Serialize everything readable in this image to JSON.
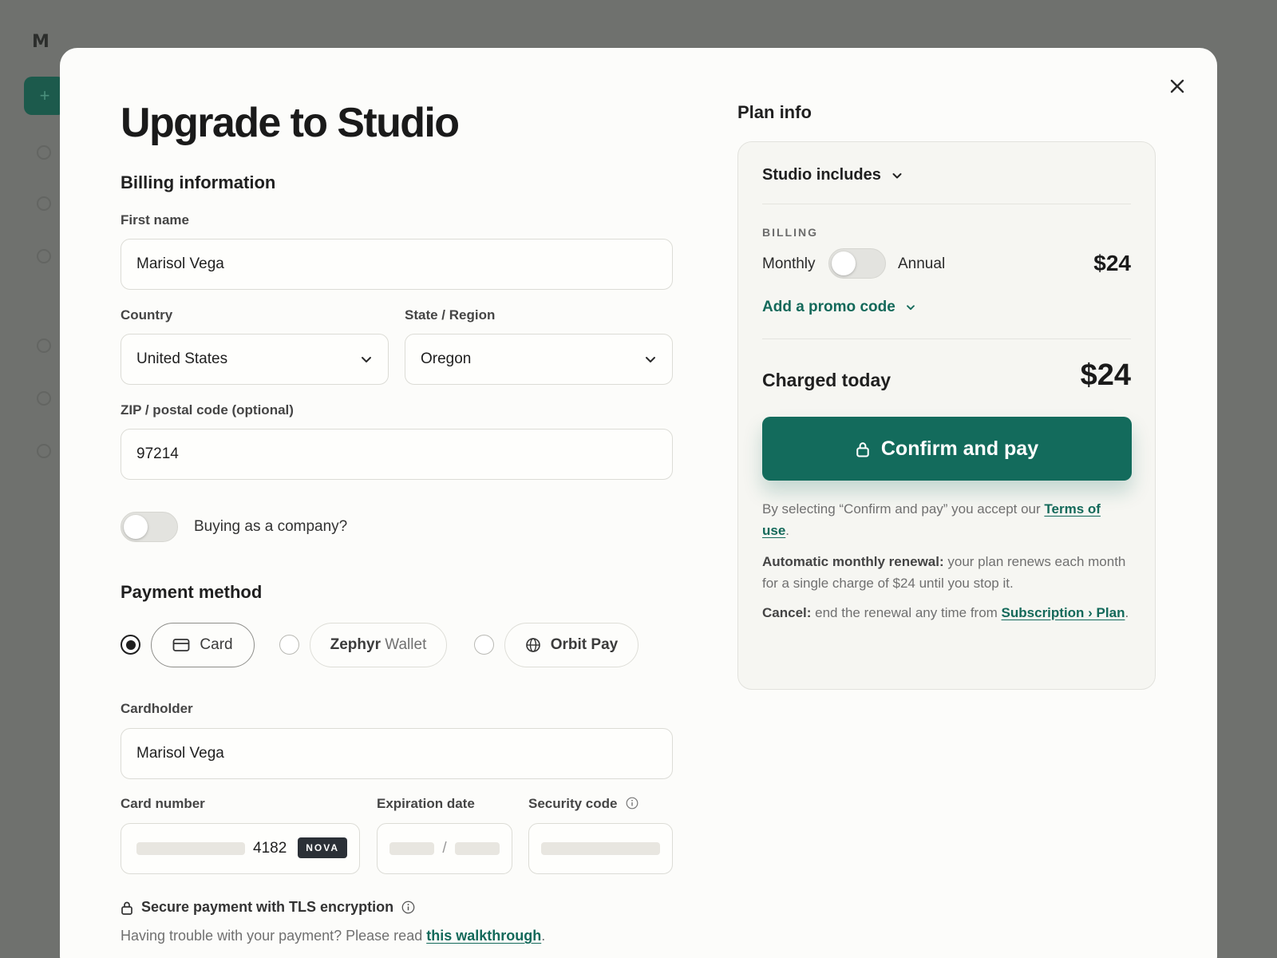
{
  "background": {
    "logo": "M",
    "new_button": "+"
  },
  "modal": {
    "title": "Upgrade to Studio",
    "billing_heading": "Billing information",
    "first_name": {
      "label": "First name",
      "value": "Marisol Vega"
    },
    "country": {
      "label": "Country",
      "value": "United States"
    },
    "state": {
      "label": "State / Region",
      "value": "Oregon"
    },
    "zip": {
      "label": "ZIP / postal code (optional)",
      "value": "97214"
    },
    "company_toggle": {
      "label": "Buying as a company?",
      "on": false
    },
    "payment_heading": "Payment method",
    "payment_options": [
      {
        "label": "Card",
        "selected": true,
        "icon": "credit-card-icon"
      },
      {
        "brand": "Zephyr",
        "suffix": "Wallet",
        "selected": false
      },
      {
        "label": "Orbit Pay",
        "selected": false,
        "icon": "globe-icon"
      }
    ],
    "cardholder": {
      "label": "Cardholder",
      "value": "Marisol Vega"
    },
    "card_number": {
      "label": "Card number",
      "last4": "4182",
      "brand_badge": "NOVA"
    },
    "expiration": {
      "label": "Expiration date",
      "separator": "/"
    },
    "security_code": {
      "label": "Security code"
    },
    "secure_note": "Secure payment with TLS encryption",
    "trouble": {
      "prefix": "Having trouble with your payment? Please read ",
      "link": "this walkthrough",
      "suffix": "."
    }
  },
  "plan": {
    "heading": "Plan info",
    "includes": "Studio includes",
    "billing_label": "BILLING",
    "monthly": "Monthly",
    "annual": "Annual",
    "billing_toggle_annual": false,
    "price": "$24",
    "promo": "Add a promo code",
    "charged_label": "Charged today",
    "charged_amount": "$24",
    "confirm_button": "Confirm and pay",
    "terms": {
      "prefix": "By selecting “Confirm and pay” you accept our ",
      "link": "Terms of use",
      "suffix": "."
    },
    "renewal": {
      "bold": "Automatic monthly renewal:",
      "text": " your plan renews each month for a single charge of $24 until you stop it."
    },
    "cancel": {
      "bold": "Cancel:",
      "text": " end the renewal any time from ",
      "link": "Subscription › Plan",
      "suffix": "."
    }
  },
  "colors": {
    "accent": "#136b5c",
    "overlay": "#6e706d",
    "badge": "#2b3037"
  }
}
